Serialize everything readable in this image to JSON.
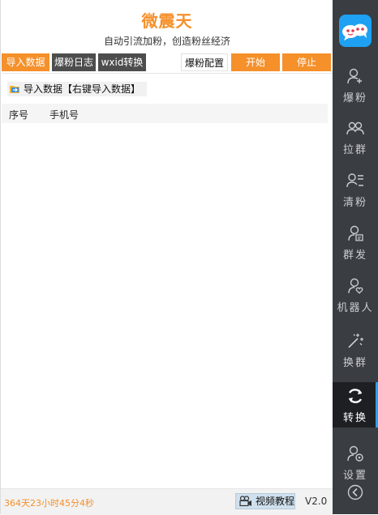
{
  "header": {
    "title": "微震天",
    "subtitle": "自动引流加粉，创造粉丝经济"
  },
  "tabs": {
    "import_data": "导入数据",
    "log": "爆粉日志",
    "wxid": "wxid转换",
    "config": "爆粉配置",
    "start": "开始",
    "stop": "停止"
  },
  "content": {
    "import_label": "导入数据【右键导入数据】",
    "columns": [
      "序号",
      "手机号"
    ]
  },
  "status": {
    "timer": "364天23小时45分4秒",
    "video_label": "视频教程",
    "version": "V2.0"
  },
  "sidebar": {
    "items": [
      {
        "label": "爆粉"
      },
      {
        "label": "拉群"
      },
      {
        "label": "清粉"
      },
      {
        "label": "群发"
      },
      {
        "label": "机器人"
      },
      {
        "label": "换群"
      },
      {
        "label": "转换"
      },
      {
        "label": "设置"
      }
    ],
    "active_index": 6
  },
  "colors": {
    "accent": "#f5902a",
    "sidebar_bg": "#3a3d42",
    "active_bar": "#2aa0f0"
  }
}
